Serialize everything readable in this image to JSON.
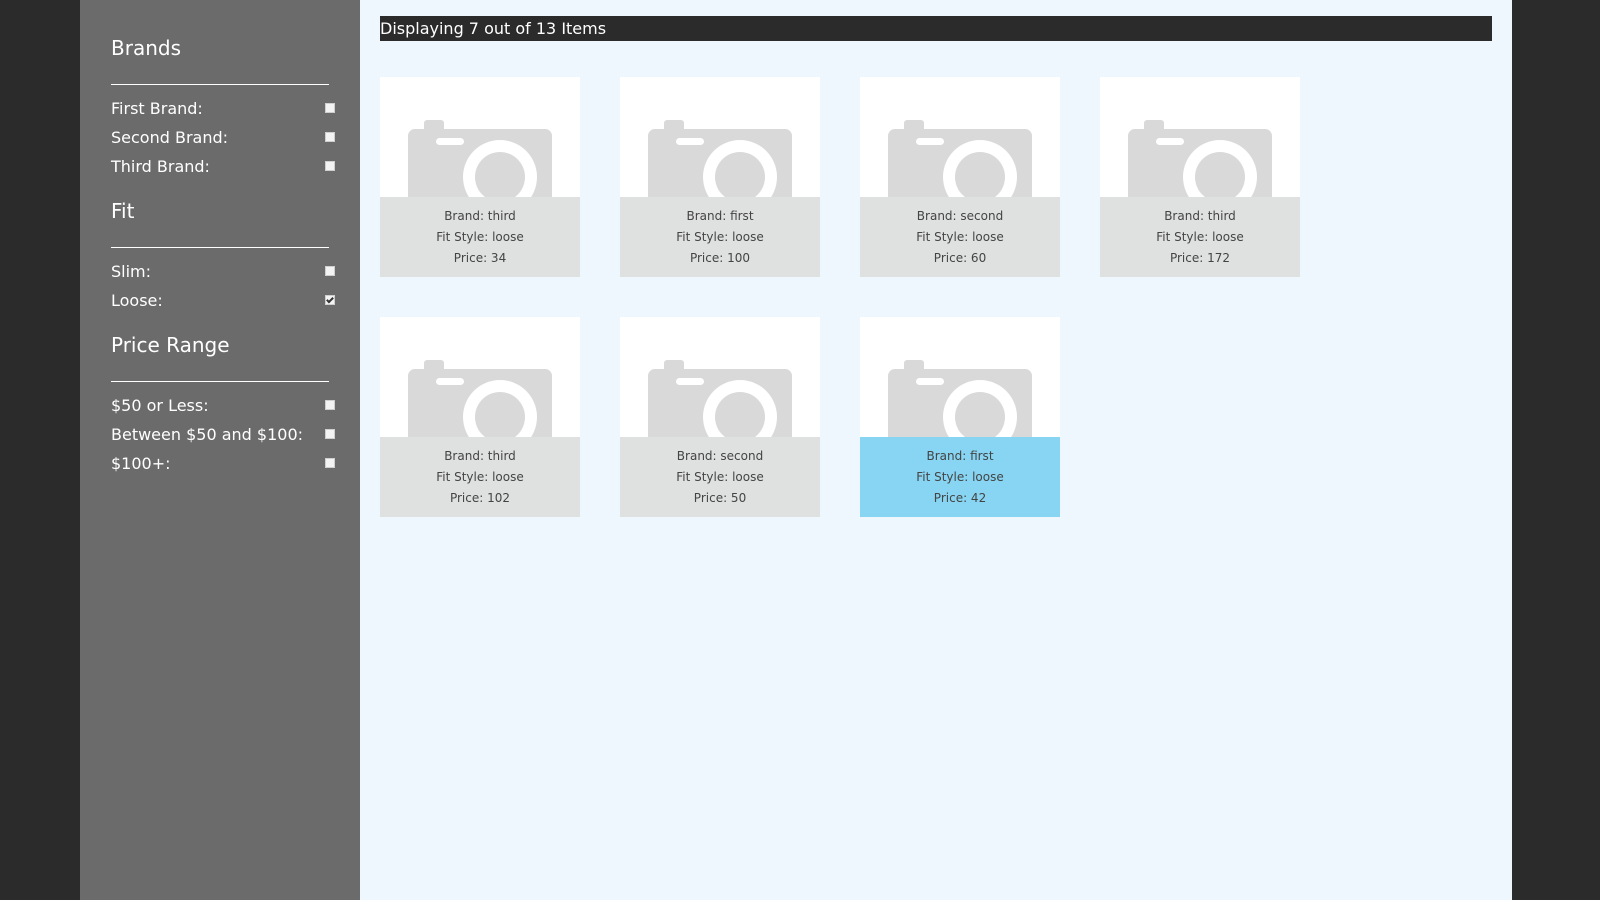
{
  "sidebar": {
    "groups": [
      {
        "title": "Brands",
        "options": [
          {
            "label": "First Brand:",
            "checked": false
          },
          {
            "label": "Second Brand:",
            "checked": false
          },
          {
            "label": "Third Brand:",
            "checked": false
          }
        ]
      },
      {
        "title": "Fit",
        "options": [
          {
            "label": "Slim:",
            "checked": false
          },
          {
            "label": "Loose:",
            "checked": true
          }
        ]
      },
      {
        "title": "Price Range",
        "options": [
          {
            "label": "$50 or Less:",
            "checked": false
          },
          {
            "label": "Between $50 and $100:",
            "checked": false
          },
          {
            "label": "$100+:",
            "checked": false
          }
        ]
      }
    ]
  },
  "status": {
    "text": "Displaying 7 out of 13 Items"
  },
  "products": [
    {
      "brand": "Brand: third",
      "fit": "Fit Style: loose",
      "price": "Price: 34",
      "highlighted": false
    },
    {
      "brand": "Brand: first",
      "fit": "Fit Style: loose",
      "price": "Price: 100",
      "highlighted": false
    },
    {
      "brand": "Brand: second",
      "fit": "Fit Style: loose",
      "price": "Price: 60",
      "highlighted": false
    },
    {
      "brand": "Brand: third",
      "fit": "Fit Style: loose",
      "price": "Price: 172",
      "highlighted": false
    },
    {
      "brand": "Brand: third",
      "fit": "Fit Style: loose",
      "price": "Price: 102",
      "highlighted": false
    },
    {
      "brand": "Brand: second",
      "fit": "Fit Style: loose",
      "price": "Price: 50",
      "highlighted": false
    },
    {
      "brand": "Brand: first",
      "fit": "Fit Style: loose",
      "price": "Price: 42",
      "highlighted": true
    }
  ],
  "icons": {
    "product_image": "camera-placeholder-icon",
    "checkbox": "checkbox-icon"
  },
  "colors": {
    "sidebar_bg": "#6b6b6b",
    "main_bg": "#eef6fe",
    "status_bg": "#2b2b2b",
    "card_info_bg": "#dfe0e0",
    "card_highlight_bg": "#87d5f2"
  }
}
